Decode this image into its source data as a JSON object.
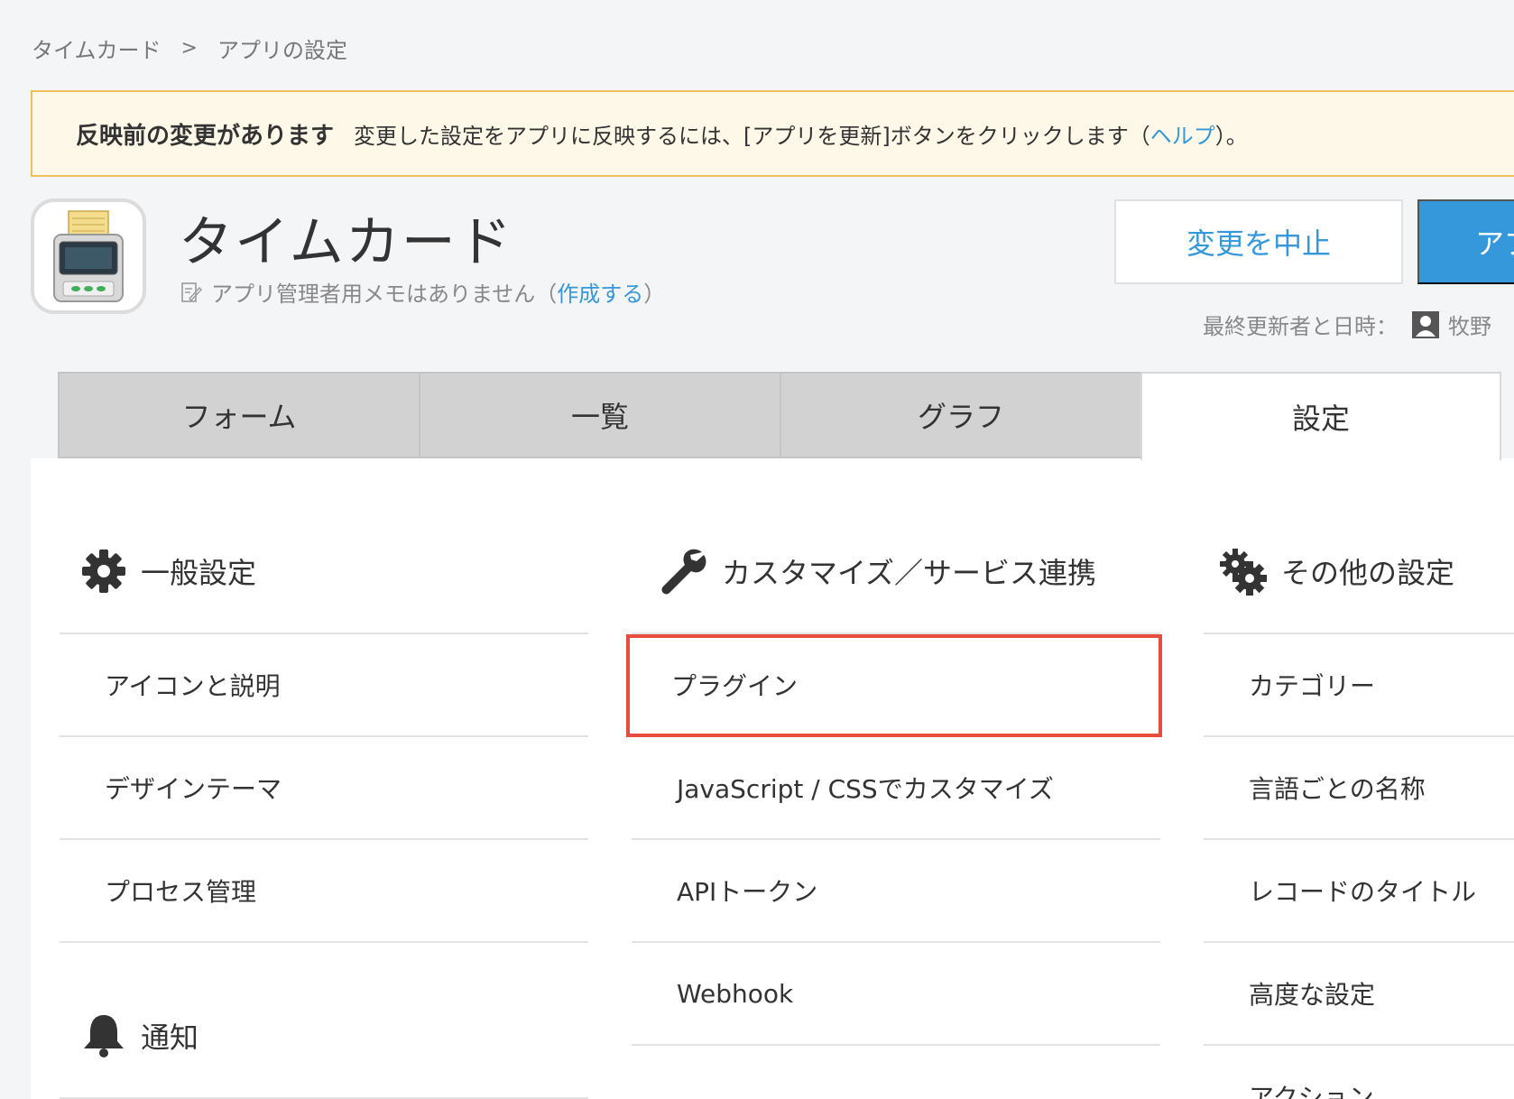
{
  "breadcrumb": {
    "root": "タイムカード",
    "separator": ">",
    "current": "アプリの設定"
  },
  "notice": {
    "title": "反映前の変更があります",
    "message": "変更した設定をアプリに反映するには、[アプリを更新]ボタンをクリックします（",
    "help_link": "ヘルプ",
    "message_end": "）。"
  },
  "app": {
    "title": "タイムカード",
    "memo_text": "アプリ管理者用メモはありません（",
    "memo_link": "作成する",
    "memo_end": "）"
  },
  "actions": {
    "cancel_label": "変更を中止",
    "update_label": "アプ"
  },
  "last_updated": {
    "label": "最終更新者と日時：",
    "user": "牧野 "
  },
  "tabs": [
    {
      "label": "フォーム"
    },
    {
      "label": "一覧"
    },
    {
      "label": "グラフ"
    },
    {
      "label": "設定"
    }
  ],
  "sections": {
    "general": {
      "title": "一般設定",
      "icon": "gear-icon",
      "items": [
        "アイコンと説明",
        "デザインテーマ",
        "プロセス管理"
      ]
    },
    "notify": {
      "title": "通知",
      "icon": "bell-icon"
    },
    "customize": {
      "title": "カスタマイズ／サービス連携",
      "icon": "wrench-icon",
      "items": [
        "プラグイン",
        "JavaScript / CSSでカスタマイズ",
        "APIトークン",
        "Webhook"
      ]
    },
    "other": {
      "title": "その他の設定",
      "icon": "gears-icon",
      "items": [
        "カテゴリー",
        "言語ごとの名称",
        "レコードのタイトル",
        "高度な設定",
        "アクション"
      ]
    }
  },
  "colors": {
    "accent": "#3498db",
    "highlight": "#e74c3c",
    "notice_border": "#f0c15b"
  }
}
